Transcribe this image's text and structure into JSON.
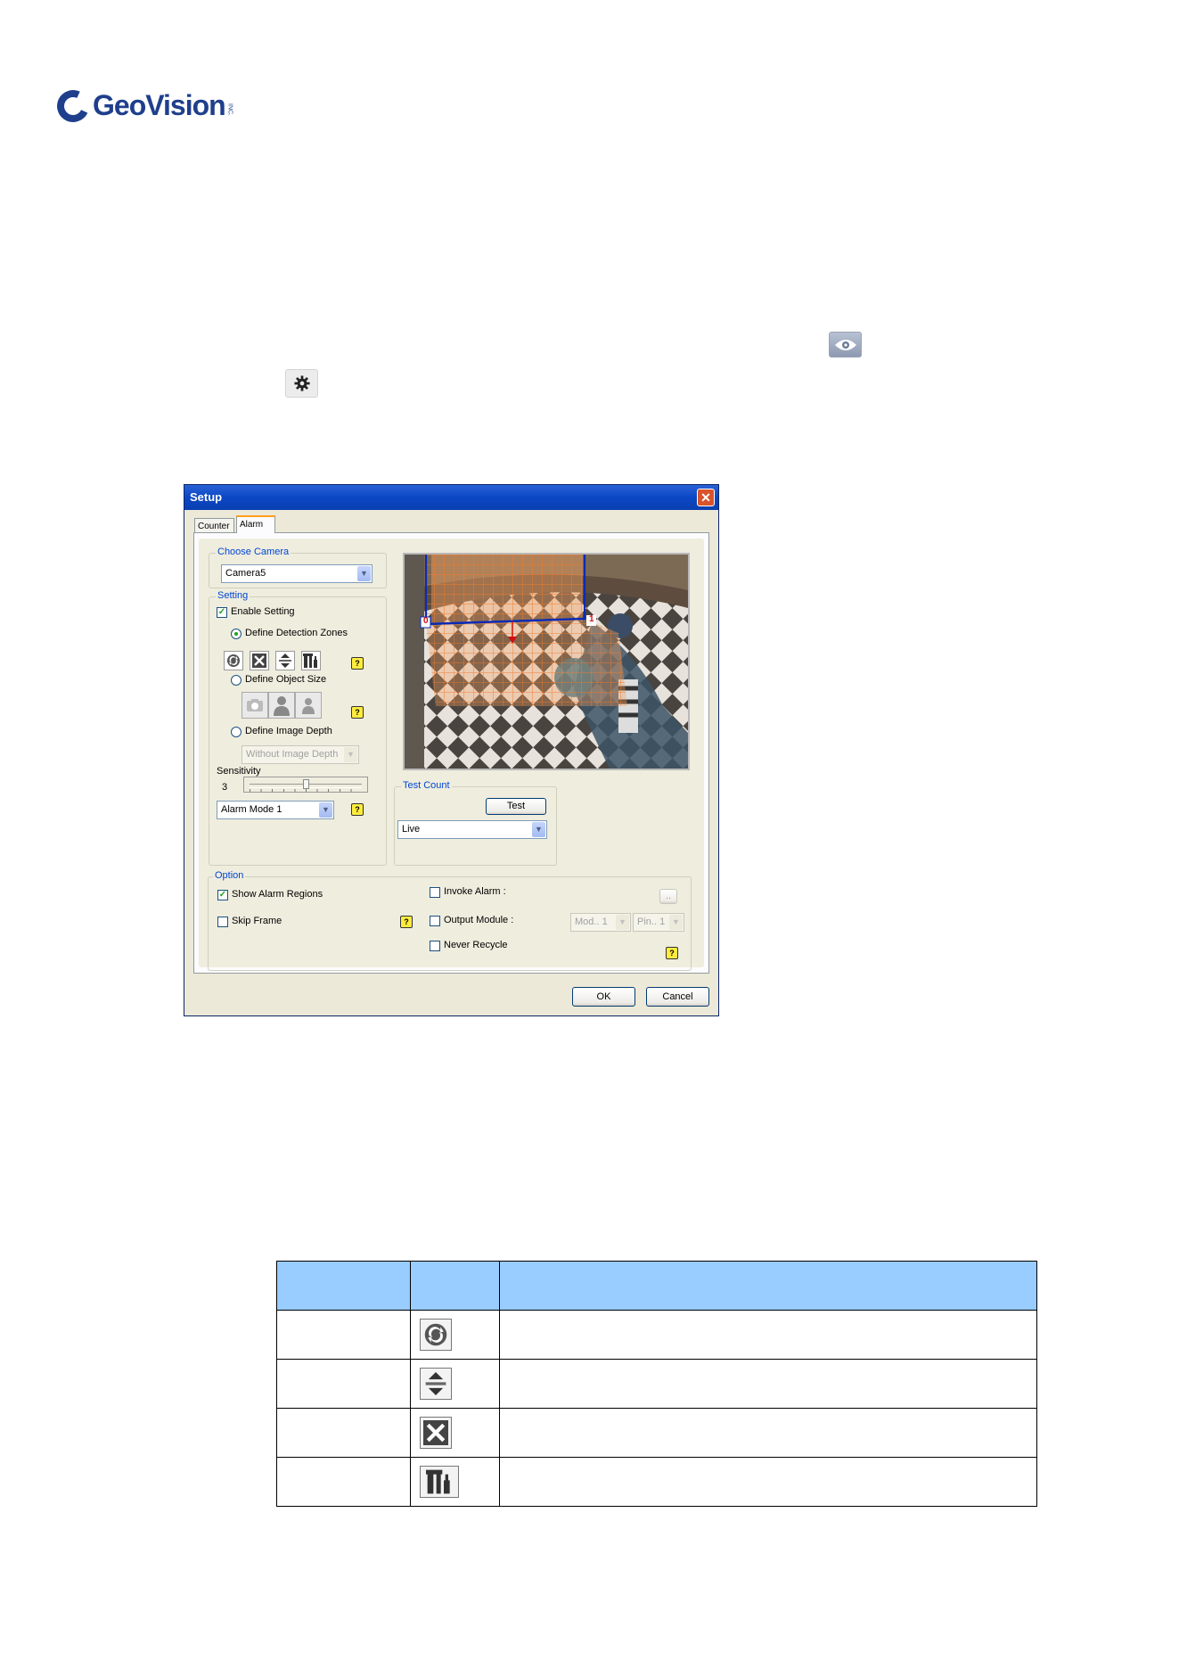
{
  "logo": {
    "text": "GeoVision",
    "tm": "INC."
  },
  "dialog": {
    "title": "Setup",
    "tabs": [
      "Counter",
      "Alarm"
    ],
    "choose_camera": {
      "title": "Choose Camera",
      "value": "Camera5"
    },
    "setting": {
      "title": "Setting",
      "enable_setting": "Enable Setting",
      "define_detection_zones": "Define Detection Zones",
      "define_object_size": "Define Object Size",
      "define_image_depth": "Define Image Depth",
      "image_depth_value": "Without Image Depth",
      "sensitivity_label": "Sensitivity",
      "sensitivity_value": "3",
      "alarm_mode": "Alarm Mode 1"
    },
    "preview": {
      "zone_label_0": "0",
      "zone_label_1": "1"
    },
    "test_count": {
      "title": "Test Count",
      "test_button": "Test",
      "source": "Live"
    },
    "option": {
      "title": "Option",
      "show_alarm_regions": "Show Alarm Regions",
      "skip_frame": "Skip Frame",
      "invoke_alarm": "Invoke Alarm :",
      "browse": "..",
      "output_module": "Output Module :",
      "module_value": "Mod.. 1",
      "pin_value": "Pin.. 1",
      "never_recycle": "Never Recycle"
    },
    "ok": "OK",
    "cancel": "Cancel",
    "help_glyph": "?",
    "close_glyph": "✕"
  }
}
